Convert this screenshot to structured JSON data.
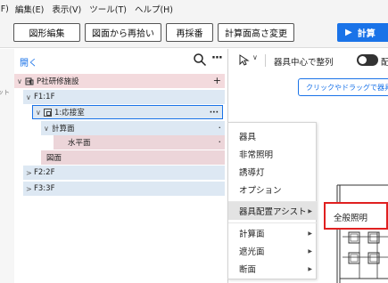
{
  "menubar": {
    "items": [
      "(F)",
      "編集(E)",
      "表示(V)",
      "ツール(T)",
      "ヘルプ(H)"
    ]
  },
  "toolbar": {
    "buttons": [
      "図形編集",
      "図面から再拾い",
      "再採番",
      "計算面高さ変更"
    ],
    "primary": "計算"
  },
  "leftstrip": {
    "fragment": "ット"
  },
  "panel": {
    "open_link": "開く"
  },
  "tree": [
    {
      "label": "P社研修施設",
      "toggle": "∨",
      "action": "+"
    },
    {
      "label": "F1:1F",
      "toggle": "∨",
      "action": ""
    },
    {
      "label": "1:応接室",
      "toggle": "∨",
      "action": "···"
    },
    {
      "label": "計算面",
      "toggle": "∨",
      "action": "·"
    },
    {
      "label": "水平面",
      "toggle": "",
      "action": "·"
    },
    {
      "label": "図面",
      "toggle": "",
      "action": ""
    },
    {
      "label": "F2:2F",
      "toggle": ">",
      "action": ""
    },
    {
      "label": "F3:3F",
      "toggle": ">",
      "action": ""
    }
  ],
  "canvas": {
    "align_label": "器具中心で整列",
    "place_label": "配",
    "hint": "クリックやドラッグで器具を追"
  },
  "context_menu": {
    "items": [
      {
        "label": "器具",
        "submenu": false
      },
      {
        "label": "非常照明",
        "submenu": false
      },
      {
        "label": "誘導灯",
        "submenu": false
      },
      {
        "label": "オプション",
        "submenu": false
      },
      {
        "label": "器具配置アシスト",
        "submenu": true
      },
      {
        "label": "計算面",
        "submenu": true
      },
      {
        "label": "遮光面",
        "submenu": true
      },
      {
        "label": "断面",
        "submenu": true
      }
    ]
  },
  "submenu": {
    "item": "全般照明"
  },
  "colors": {
    "accent": "#1a73e8",
    "highlight": "#e02020"
  }
}
